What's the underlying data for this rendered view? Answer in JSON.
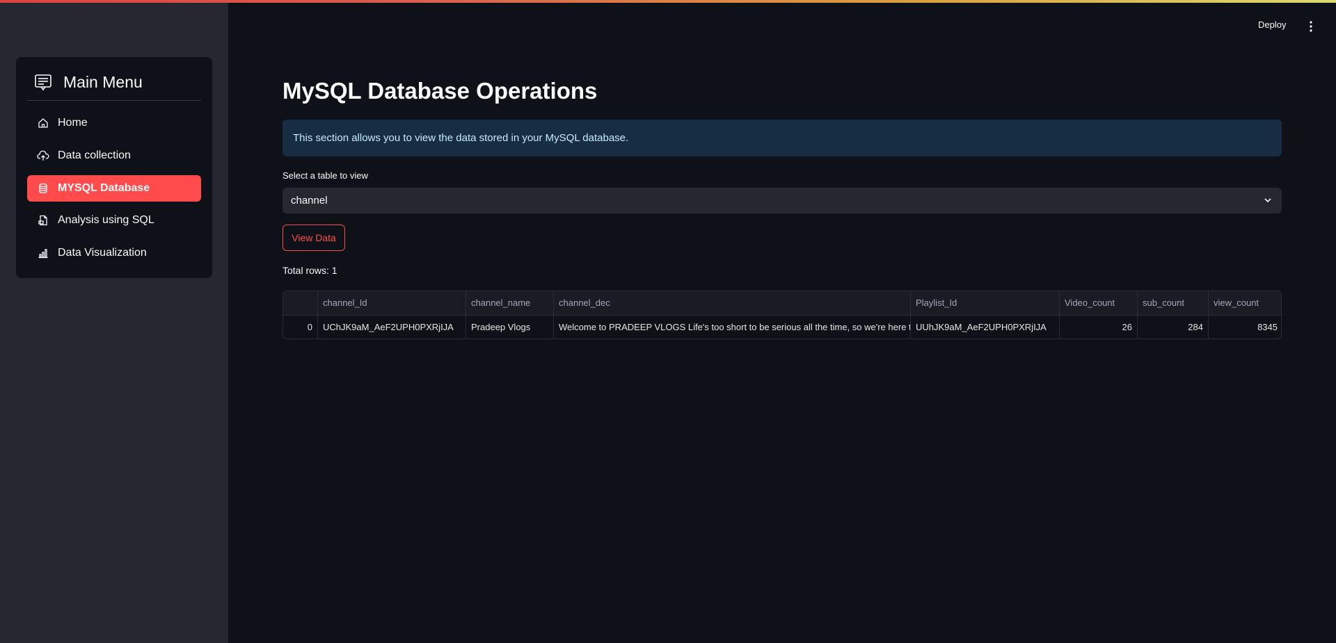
{
  "header": {
    "deploy_label": "Deploy"
  },
  "sidebar": {
    "menu_title": "Main Menu",
    "items": [
      {
        "label": "Home",
        "icon": "home-icon",
        "active": false
      },
      {
        "label": "Data collection",
        "icon": "cloud-upload-icon",
        "active": false
      },
      {
        "label": "MYSQL Database",
        "icon": "database-icon",
        "active": true
      },
      {
        "label": "Analysis using SQL",
        "icon": "file-sql-icon",
        "active": false
      },
      {
        "label": "Data Visualization",
        "icon": "bar-chart-icon",
        "active": false
      }
    ],
    "accent_color": "#ff4b4b"
  },
  "main": {
    "title": "MySQL Database Operations",
    "info_text": "This section allows you to view the data stored in your MySQL database.",
    "select_label": "Select a table to view",
    "select_value": "channel",
    "view_button_label": "View Data",
    "total_rows_text": "Total rows: 1"
  },
  "table": {
    "columns": [
      "",
      "channel_Id",
      "channel_name",
      "channel_dec",
      "Playlist_Id",
      "Video_count",
      "sub_count",
      "view_count"
    ],
    "rows": [
      [
        "0",
        "UChJK9aM_AeF2UPH0PXRjIJA",
        "Pradeep Vlogs",
        "Welcome to PRADEEP VLOGS  Life's too short to be serious all the time, so we're here to bring",
        "UUhJK9aM_AeF2UPH0PXRjIJA",
        "26",
        "284",
        "8345"
      ]
    ]
  }
}
